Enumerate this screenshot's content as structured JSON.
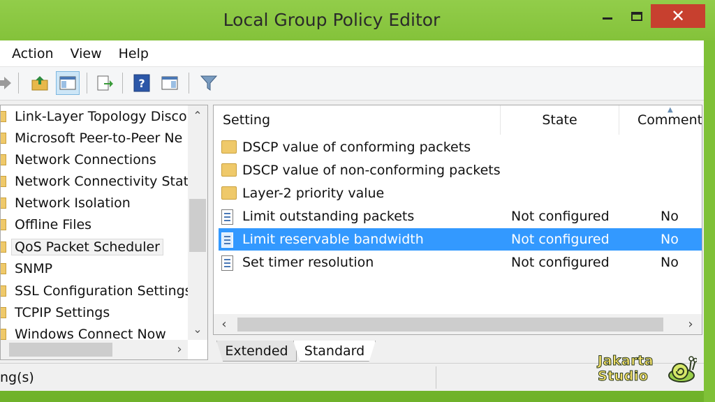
{
  "window": {
    "title": "Local Group Policy Editor",
    "minimize_icon": "minimize-icon",
    "maximize_icon": "maximize-icon",
    "close_glyph": "✕"
  },
  "menu": [
    "Action",
    "View",
    "Help"
  ],
  "toolbar": {
    "icons": [
      "forward-arrow-icon",
      "up-folder-icon",
      "show-hide-tree-icon",
      "export-list-icon",
      "help-icon",
      "show-hide-action-pane-icon",
      "filter-icon"
    ]
  },
  "tree": {
    "items": [
      {
        "label": "Link-Layer Topology Disco",
        "selected": false
      },
      {
        "label": "Microsoft Peer-to-Peer Ne",
        "selected": false
      },
      {
        "label": "Network Connections",
        "selected": false
      },
      {
        "label": "Network Connectivity Stat",
        "selected": false
      },
      {
        "label": "Network Isolation",
        "selected": false
      },
      {
        "label": "Offline Files",
        "selected": false
      },
      {
        "label": "QoS Packet Scheduler",
        "selected": true
      },
      {
        "label": "SNMP",
        "selected": false
      },
      {
        "label": "SSL Configuration Settings",
        "selected": false
      },
      {
        "label": "TCPIP Settings",
        "selected": false
      },
      {
        "label": "Windows Connect Now",
        "selected": false
      }
    ],
    "scroll_up_glyph": "⌃",
    "scroll_down_glyph": "⌄",
    "scroll_right_glyph": "›"
  },
  "list": {
    "columns": {
      "setting": "Setting",
      "state": "State",
      "comment": "Comment"
    },
    "rows": [
      {
        "type": "folder",
        "name": "DSCP value of conforming packets",
        "state": "",
        "comment": ""
      },
      {
        "type": "folder",
        "name": "DSCP value of non-conforming packets",
        "state": "",
        "comment": ""
      },
      {
        "type": "folder",
        "name": "Layer-2 priority value",
        "state": "",
        "comment": ""
      },
      {
        "type": "policy",
        "name": "Limit outstanding packets",
        "state": "Not configured",
        "comment": "No"
      },
      {
        "type": "policy",
        "name": "Limit reservable bandwidth",
        "state": "Not configured",
        "comment": "No",
        "selected": true
      },
      {
        "type": "policy",
        "name": "Set timer resolution",
        "state": "Not configured",
        "comment": "No"
      }
    ],
    "scroll_left_glyph": "‹",
    "scroll_right_glyph": "›"
  },
  "tabs": [
    {
      "label": "Extended",
      "active": false
    },
    {
      "label": "Standard",
      "active": true
    }
  ],
  "status": {
    "text": "ng(s)"
  },
  "watermark": {
    "line1": "Jakarta",
    "line2": "Studio"
  }
}
